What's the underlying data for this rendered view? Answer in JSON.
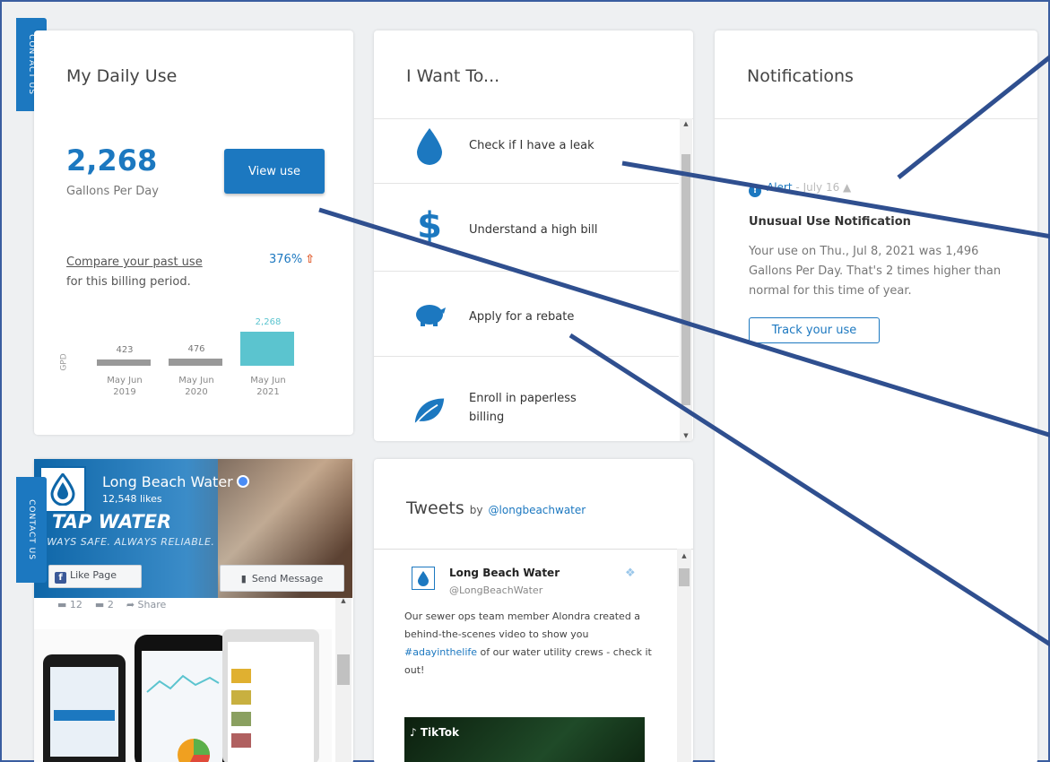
{
  "sidebar_tab": {
    "label": "CONTACT US"
  },
  "daily_use": {
    "title": "My Daily Use",
    "value": "2,268",
    "unit": "Gallons Per Day",
    "view_button": "View use",
    "compare_link": "Compare your past use",
    "compare_suffix": "for this billing period.",
    "percent": "376%",
    "axis_label": "GPD"
  },
  "chart_data": {
    "type": "bar",
    "categories": [
      "May Jun 2019",
      "May Jun 2020",
      "May Jun 2021"
    ],
    "values": [
      423,
      476,
      2268
    ],
    "value_labels": [
      "423",
      "476",
      "2,268"
    ],
    "ylabel": "GPD",
    "highlight_color": "#5bc4cf",
    "base_color": "#999999"
  },
  "want_to": {
    "title": "I Want To...",
    "items": [
      {
        "label": "Check if I have a leak",
        "icon": "water-drop-icon"
      },
      {
        "label": "Understand a high bill",
        "icon": "dollar-icon"
      },
      {
        "label": "Apply for a rebate",
        "icon": "piggy-bank-icon"
      },
      {
        "label": "Enroll in paperless billing",
        "icon": "leaf-icon"
      }
    ]
  },
  "notifications": {
    "title": "Notifications",
    "alert_type": "Alert",
    "alert_date": "July 16",
    "heading": "Unusual Use Notification",
    "body": "Your use on Thu., Jul 8, 2021 was 1,496 Gallons Per Day. That's 2 times higher than normal for this time of year.",
    "button": "Track your use"
  },
  "facebook": {
    "page_name": "Long Beach Water",
    "likes": "12,548 likes",
    "slogan": "TAP WATER",
    "tagline": "ALWAYS SAFE. ALWAYS RELIABLE.",
    "like_button": "Like Page",
    "send_button": "Send Message",
    "likes_count": "12",
    "comments_count": "2",
    "share_label": "Share"
  },
  "tweets": {
    "title": "Tweets",
    "by": "by",
    "handle": "@longbeachwater",
    "tweet_name": "Long Beach Water",
    "tweet_handle": "@LongBeachWater",
    "tweet_body_1": "Our sewer ops team member Alondra created a behind-the-scenes video to show you ",
    "tweet_hashtag": "#adayinthelife",
    "tweet_body_2": " of our water utility crews - check it out!",
    "video_brand": "TikTok"
  },
  "colors": {
    "accent": "#1c78c0",
    "highlight": "#5bc4cf",
    "arrow_up": "#e05a2b",
    "annotation": "#2f4f8f"
  }
}
